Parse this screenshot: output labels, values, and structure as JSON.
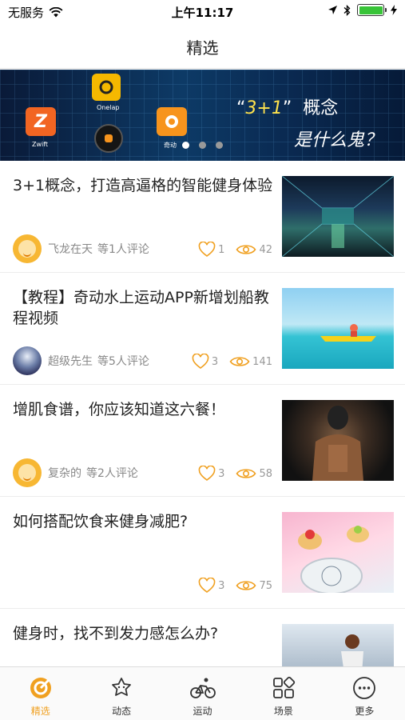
{
  "status_bar": {
    "carrier": "无服务",
    "time": "上午11:17",
    "battery_level": 1.0
  },
  "nav": {
    "title": "精选"
  },
  "banner": {
    "apps": [
      {
        "icon": "zwift-app-icon",
        "label": "Zwift",
        "color": "#f26522"
      },
      {
        "icon": "onelap-app-icon",
        "label": "Onelap",
        "color": "#f5b800"
      },
      {
        "icon": "qidong-app-icon",
        "label": "奇动",
        "color": "#f7941d"
      }
    ],
    "headline_open": "“",
    "headline_highlight": "3+1",
    "headline_close": "”",
    "headline_suffix": "概念",
    "subline": "是什么鬼？",
    "page_count": 3,
    "active_page": 0
  },
  "articles": [
    {
      "title": "3+1概念，打造高逼格的智能健身体验",
      "author": "飞龙在天",
      "comments": "等1人评论",
      "likes": "1",
      "views": "42",
      "avatar": "face"
    },
    {
      "title": "【教程】奇动水上运动APP新增划船教程视频",
      "author": "超级先生",
      "comments": "等5人评论",
      "likes": "3",
      "views": "141",
      "avatar": "night"
    },
    {
      "title": "增肌食谱，你应该知道这六餐！",
      "author": "复杂的",
      "comments": "等2人评论",
      "likes": "3",
      "views": "58",
      "avatar": "face"
    },
    {
      "title": "如何搭配饮食来健身减肥?",
      "author": "",
      "comments": "",
      "likes": "3",
      "views": "75",
      "avatar": ""
    },
    {
      "title": "健身时，找不到发力感怎么办?",
      "author": "",
      "comments": "",
      "likes": "",
      "views": "",
      "avatar": ""
    }
  ],
  "tabs": [
    {
      "label": "精选",
      "icon": "featured-icon",
      "active": true
    },
    {
      "label": "动态",
      "icon": "feed-icon",
      "active": false
    },
    {
      "label": "运动",
      "icon": "cycling-icon",
      "active": false
    },
    {
      "label": "场景",
      "icon": "scenes-icon",
      "active": false
    },
    {
      "label": "更多",
      "icon": "more-icon",
      "active": false
    }
  ],
  "colors": {
    "accent": "#f0a020",
    "text": "#222222",
    "meta": "#888888"
  }
}
